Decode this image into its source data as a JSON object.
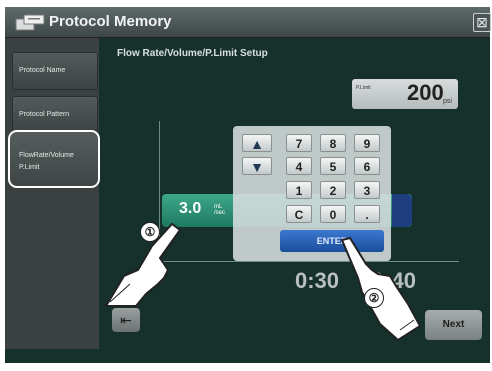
{
  "window": {
    "title": "Protocol Memory",
    "close_glyph": "⊠"
  },
  "sidebar": {
    "items": [
      {
        "label": "Protocol Name"
      },
      {
        "label": "Protocol Pattern"
      },
      {
        "label_line1": "FlowRate/Volume",
        "label_line2": "P.Limit",
        "active": true
      }
    ]
  },
  "main": {
    "title": "Flow Rate/Volume/P.Limit Setup",
    "plimit": {
      "label": "P.Limit",
      "value": "200",
      "unit": "psi"
    },
    "flow": {
      "value": "3.0",
      "unit_top": "mL",
      "unit_bottom": "/sec"
    },
    "time_left": "0:30",
    "time_right": "0:40",
    "back_glyph": "⇤",
    "next_label": "Next"
  },
  "keypad": {
    "up": "▲",
    "down": "▼",
    "keys": [
      "7",
      "8",
      "9",
      "4",
      "5",
      "6",
      "1",
      "2",
      "3",
      "C",
      "0",
      "."
    ],
    "enter": "ENTER"
  },
  "callouts": [
    "①",
    "②"
  ],
  "colors": {
    "background": "#16302c",
    "flow_bar": "#1d7a60",
    "enter": "#1b4f9b"
  }
}
